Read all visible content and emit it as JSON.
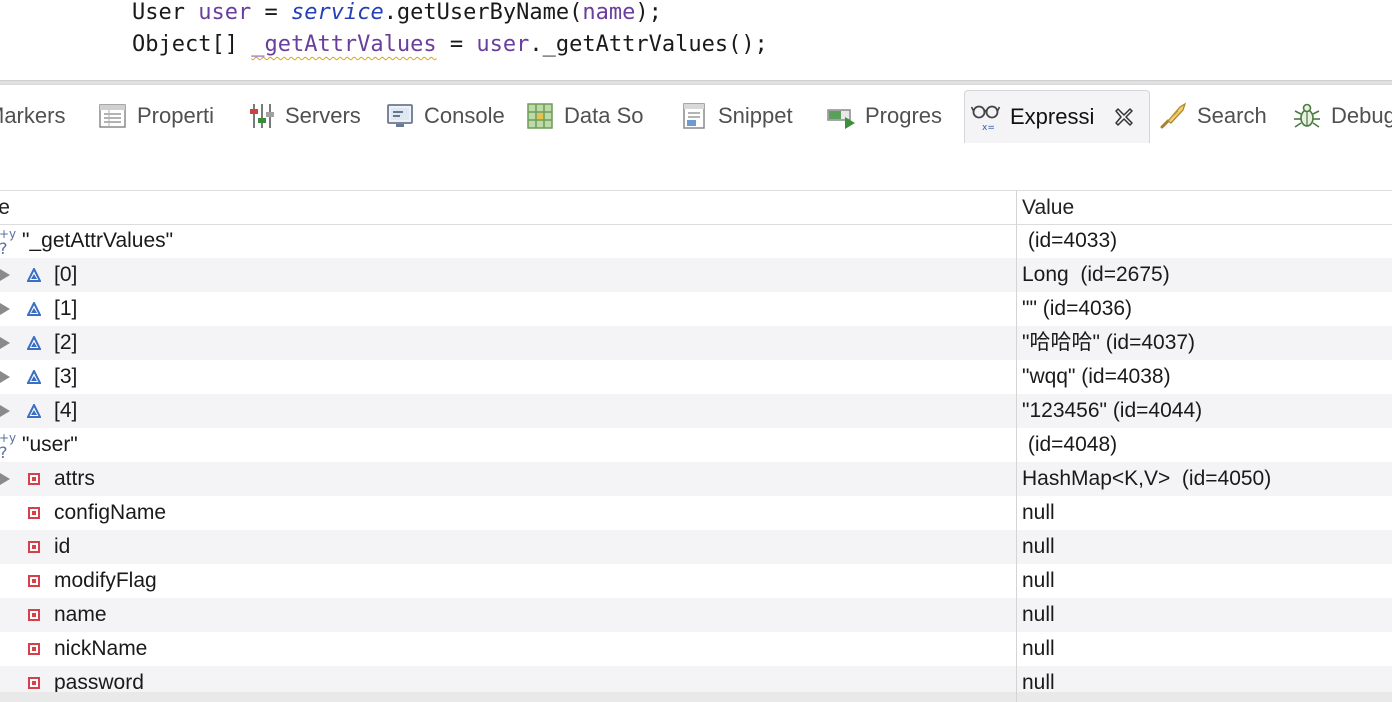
{
  "editor": {
    "line1": {
      "type_name": "User",
      "var_name": "user",
      "assign": " = ",
      "receiver": "service",
      "call": ".getUserByName(",
      "arg": "name",
      "end": ");"
    },
    "line2": {
      "type_name": "Object[]",
      "var_name": "_getAttrValues",
      "assign": " = ",
      "receiver": "user",
      "call": "._getAttrValues();"
    }
  },
  "tabs": [
    {
      "label": "Markers",
      "icon": "markers-icon",
      "active": false
    },
    {
      "label": "Properti",
      "icon": "properties-icon",
      "active": false
    },
    {
      "label": "Servers",
      "icon": "servers-icon",
      "active": false
    },
    {
      "label": "Console",
      "icon": "console-icon",
      "active": false
    },
    {
      "label": "Data So",
      "icon": "data-source-icon",
      "active": false
    },
    {
      "label": "Snippet",
      "icon": "snippet-icon",
      "active": false
    },
    {
      "label": "Progres",
      "icon": "progress-icon",
      "active": false
    },
    {
      "label": "Expressi",
      "icon": "expressions-icon",
      "active": true
    },
    {
      "label": "Search",
      "icon": "search-icon",
      "active": false
    },
    {
      "label": "Debug",
      "icon": "debug-bug-icon",
      "active": false
    }
  ],
  "table": {
    "header_name": "Name",
    "header_value": "Value",
    "rows": [
      {
        "name": "\"_getAttrValues\"",
        "value": " (id=4033)",
        "kind": "watch",
        "expander": false
      },
      {
        "name": "[0]",
        "value": "Long  (id=2675)",
        "kind": "element",
        "expander": true
      },
      {
        "name": "[1]",
        "value": "\"\" (id=4036)",
        "kind": "element",
        "expander": true
      },
      {
        "name": "[2]",
        "value": "\"哈哈哈\" (id=4037)",
        "kind": "element",
        "expander": true
      },
      {
        "name": "[3]",
        "value": "\"wqq\" (id=4038)",
        "kind": "element",
        "expander": true
      },
      {
        "name": "[4]",
        "value": "\"123456\" (id=4044)",
        "kind": "element",
        "expander": true
      },
      {
        "name": "\"user\"",
        "value": " (id=4048)",
        "kind": "watch",
        "expander": false
      },
      {
        "name": "attrs",
        "value": "HashMap<K,V>  (id=4050)",
        "kind": "field",
        "expander": true
      },
      {
        "name": "configName",
        "value": "null",
        "kind": "field",
        "expander": false
      },
      {
        "name": "id",
        "value": "null",
        "kind": "field",
        "expander": false
      },
      {
        "name": "modifyFlag",
        "value": "null",
        "kind": "field",
        "expander": false
      },
      {
        "name": "name",
        "value": "null",
        "kind": "field",
        "expander": false
      },
      {
        "name": "nickName",
        "value": "null",
        "kind": "field",
        "expander": false
      },
      {
        "name": "password",
        "value": "null",
        "kind": "field",
        "expander": false
      }
    ]
  },
  "colors": {
    "element_icon": "#3a6fc4",
    "field_icon": "#d6404a",
    "variable": "#6a3e9c",
    "method_receiver": "#2440b8",
    "warning_underline": "#d6a31a",
    "alt_row": "#f4f4f7"
  }
}
